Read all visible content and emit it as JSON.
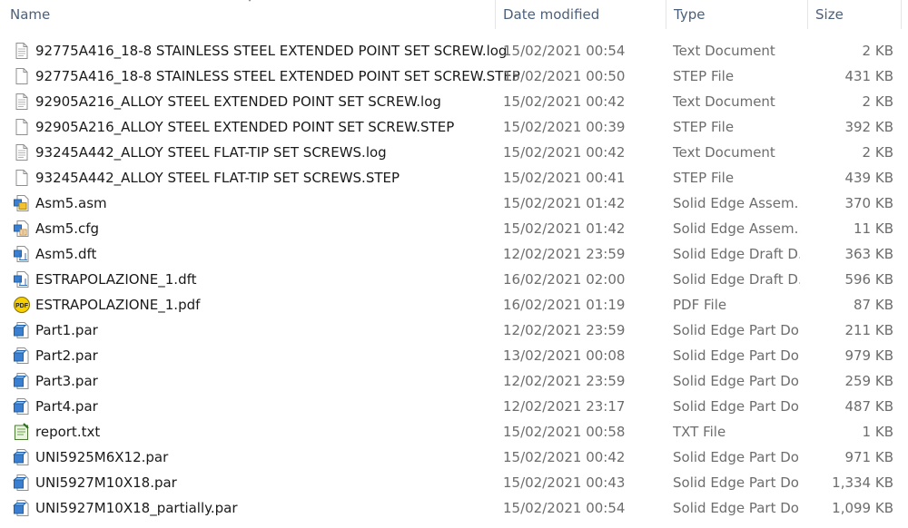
{
  "columns": {
    "name": "Name",
    "date": "Date modified",
    "type": "Type",
    "size": "Size"
  },
  "files": [
    {
      "name": "92775A416_18-8 STAINLESS STEEL EXTENDED POINT SET SCREW.log",
      "date": "15/02/2021 00:54",
      "type": "Text Document",
      "size": "2 KB",
      "icon": "text-document-icon"
    },
    {
      "name": "92775A416_18-8 STAINLESS STEEL EXTENDED POINT SET SCREW.STEP",
      "date": "15/02/2021 00:50",
      "type": "STEP File",
      "size": "431 KB",
      "icon": "blank-file-icon"
    },
    {
      "name": "92905A216_ALLOY STEEL EXTENDED POINT SET SCREW.log",
      "date": "15/02/2021 00:42",
      "type": "Text Document",
      "size": "2 KB",
      "icon": "text-document-icon"
    },
    {
      "name": "92905A216_ALLOY STEEL EXTENDED POINT SET SCREW.STEP",
      "date": "15/02/2021 00:39",
      "type": "STEP File",
      "size": "392 KB",
      "icon": "blank-file-icon"
    },
    {
      "name": "93245A442_ALLOY STEEL FLAT-TIP SET SCREWS.log",
      "date": "15/02/2021 00:42",
      "type": "Text Document",
      "size": "2 KB",
      "icon": "text-document-icon"
    },
    {
      "name": "93245A442_ALLOY STEEL FLAT-TIP SET SCREWS.STEP",
      "date": "15/02/2021 00:41",
      "type": "STEP File",
      "size": "439 KB",
      "icon": "blank-file-icon"
    },
    {
      "name": "Asm5.asm",
      "date": "15/02/2021 01:42",
      "type": "Solid Edge Assem...",
      "size": "370 KB",
      "icon": "solid-edge-assembly-icon"
    },
    {
      "name": "Asm5.cfg",
      "date": "15/02/2021 01:42",
      "type": "Solid Edge Assem...",
      "size": "11 KB",
      "icon": "solid-edge-config-icon"
    },
    {
      "name": "Asm5.dft",
      "date": "12/02/2021 23:59",
      "type": "Solid Edge Draft D...",
      "size": "363 KB",
      "icon": "solid-edge-draft-icon"
    },
    {
      "name": "ESTRAPOLAZIONE_1.dft",
      "date": "16/02/2021 02:00",
      "type": "Solid Edge Draft D...",
      "size": "596 KB",
      "icon": "solid-edge-draft-icon"
    },
    {
      "name": "ESTRAPOLAZIONE_1.pdf",
      "date": "16/02/2021 01:19",
      "type": "PDF File",
      "size": "87 KB",
      "icon": "pdf-icon"
    },
    {
      "name": "Part1.par",
      "date": "12/02/2021 23:59",
      "type": "Solid Edge Part Do...",
      "size": "211 KB",
      "icon": "solid-edge-part-icon"
    },
    {
      "name": "Part2.par",
      "date": "13/02/2021 00:08",
      "type": "Solid Edge Part Do...",
      "size": "979 KB",
      "icon": "solid-edge-part-icon"
    },
    {
      "name": "Part3.par",
      "date": "12/02/2021 23:59",
      "type": "Solid Edge Part Do...",
      "size": "259 KB",
      "icon": "solid-edge-part-icon"
    },
    {
      "name": "Part4.par",
      "date": "12/02/2021 23:17",
      "type": "Solid Edge Part Do...",
      "size": "487 KB",
      "icon": "solid-edge-part-icon"
    },
    {
      "name": "report.txt",
      "date": "15/02/2021 00:58",
      "type": "TXT File",
      "size": "1 KB",
      "icon": "notepad-icon"
    },
    {
      "name": "UNI5925M6X12.par",
      "date": "15/02/2021 00:42",
      "type": "Solid Edge Part Do...",
      "size": "971 KB",
      "icon": "solid-edge-part-icon"
    },
    {
      "name": "UNI5927M10X18.par",
      "date": "15/02/2021 00:43",
      "type": "Solid Edge Part Do...",
      "size": "1,334 KB",
      "icon": "solid-edge-part-icon"
    },
    {
      "name": "UNI5927M10X18_partially.par",
      "date": "15/02/2021 00:54",
      "type": "Solid Edge Part Do...",
      "size": "1,099 KB",
      "icon": "solid-edge-part-icon"
    }
  ]
}
